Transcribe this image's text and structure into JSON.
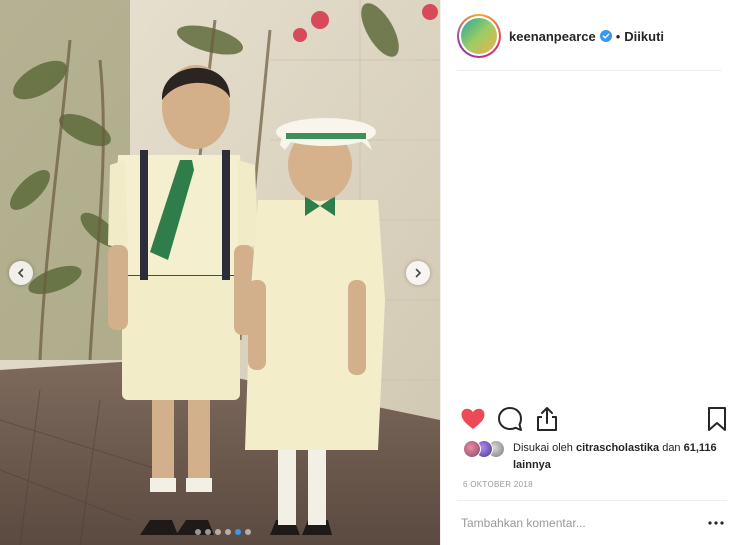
{
  "post": {
    "username": "keenanpearce",
    "follow_separator": "•",
    "follow_status": "Diikuti",
    "liked_prefix": "Disukai oleh ",
    "liked_user": "citrascholastika",
    "liked_middle": " dan ",
    "liked_count": "61,116 lainnya",
    "date": "6 OKTOBER 2018",
    "comment_placeholder": "Tambahkan komentar..."
  },
  "carousel": {
    "total_slides": 6,
    "active_slide": 5
  },
  "colors": {
    "like": "#ed4956",
    "dot_active": "#3897f0",
    "verified": "#3897f0"
  },
  "icons": {
    "like": "heart-filled-icon",
    "comment": "speech-bubble-icon",
    "share": "share-arrow-icon",
    "save": "bookmark-icon",
    "more": "ellipsis-icon",
    "verified": "verified-badge-icon"
  }
}
